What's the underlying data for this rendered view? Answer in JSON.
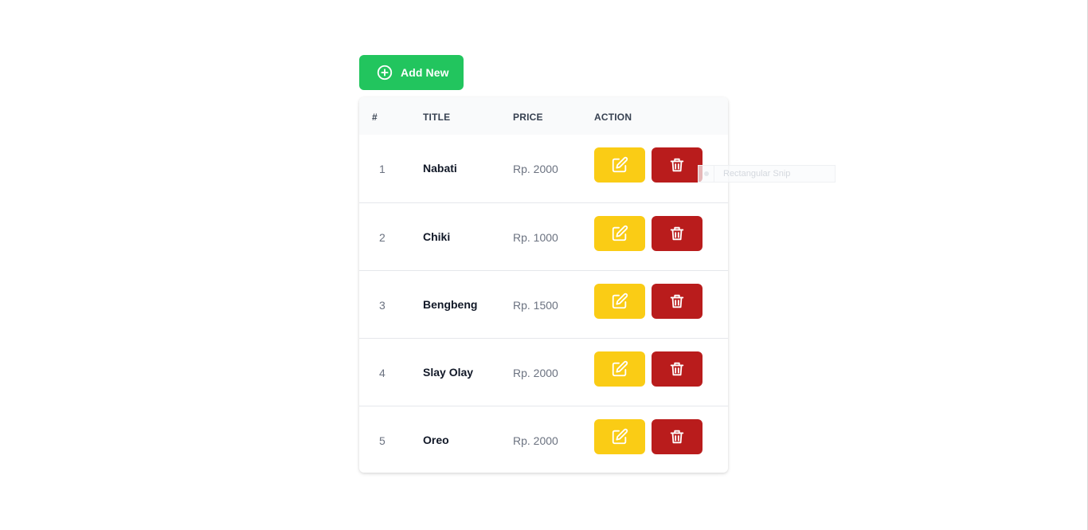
{
  "toolbar": {
    "add_label": "Add New",
    "add_color": "#22c55e"
  },
  "table": {
    "columns": [
      "#",
      "TITLE",
      "PRICE",
      "ACTION"
    ],
    "rows": [
      {
        "num": "1",
        "title": "Nabati",
        "price": "Rp. 2000"
      },
      {
        "num": "2",
        "title": "Chiki",
        "price": "Rp. 1000"
      },
      {
        "num": "3",
        "title": "Bengbeng",
        "price": "Rp. 1500"
      },
      {
        "num": "4",
        "title": "Slay Olay",
        "price": "Rp. 2000"
      },
      {
        "num": "5",
        "title": "Oreo",
        "price": "Rp. 2000"
      }
    ],
    "edit_color": "#facc15",
    "delete_color": "#b91c1c",
    "edit_icon": "pencil-square-icon",
    "delete_icon": "trash-icon"
  },
  "tooltip": {
    "text": "Rectangular Snip"
  }
}
